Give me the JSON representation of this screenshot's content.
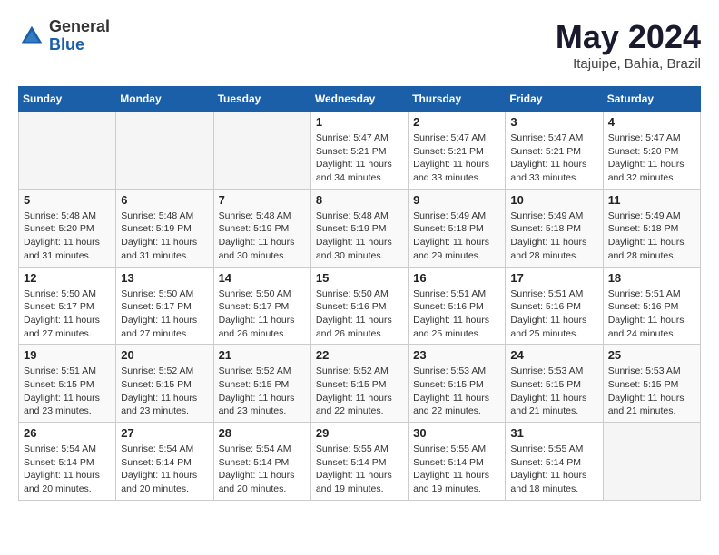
{
  "header": {
    "logo_general": "General",
    "logo_blue": "Blue",
    "month": "May 2024",
    "location": "Itajuipe, Bahia, Brazil"
  },
  "weekdays": [
    "Sunday",
    "Monday",
    "Tuesday",
    "Wednesday",
    "Thursday",
    "Friday",
    "Saturday"
  ],
  "weeks": [
    [
      {
        "day": "",
        "info": ""
      },
      {
        "day": "",
        "info": ""
      },
      {
        "day": "",
        "info": ""
      },
      {
        "day": "1",
        "info": "Sunrise: 5:47 AM\nSunset: 5:21 PM\nDaylight: 11 hours and 34 minutes."
      },
      {
        "day": "2",
        "info": "Sunrise: 5:47 AM\nSunset: 5:21 PM\nDaylight: 11 hours and 33 minutes."
      },
      {
        "day": "3",
        "info": "Sunrise: 5:47 AM\nSunset: 5:21 PM\nDaylight: 11 hours and 33 minutes."
      },
      {
        "day": "4",
        "info": "Sunrise: 5:47 AM\nSunset: 5:20 PM\nDaylight: 11 hours and 32 minutes."
      }
    ],
    [
      {
        "day": "5",
        "info": "Sunrise: 5:48 AM\nSunset: 5:20 PM\nDaylight: 11 hours and 31 minutes."
      },
      {
        "day": "6",
        "info": "Sunrise: 5:48 AM\nSunset: 5:19 PM\nDaylight: 11 hours and 31 minutes."
      },
      {
        "day": "7",
        "info": "Sunrise: 5:48 AM\nSunset: 5:19 PM\nDaylight: 11 hours and 30 minutes."
      },
      {
        "day": "8",
        "info": "Sunrise: 5:48 AM\nSunset: 5:19 PM\nDaylight: 11 hours and 30 minutes."
      },
      {
        "day": "9",
        "info": "Sunrise: 5:49 AM\nSunset: 5:18 PM\nDaylight: 11 hours and 29 minutes."
      },
      {
        "day": "10",
        "info": "Sunrise: 5:49 AM\nSunset: 5:18 PM\nDaylight: 11 hours and 28 minutes."
      },
      {
        "day": "11",
        "info": "Sunrise: 5:49 AM\nSunset: 5:18 PM\nDaylight: 11 hours and 28 minutes."
      }
    ],
    [
      {
        "day": "12",
        "info": "Sunrise: 5:50 AM\nSunset: 5:17 PM\nDaylight: 11 hours and 27 minutes."
      },
      {
        "day": "13",
        "info": "Sunrise: 5:50 AM\nSunset: 5:17 PM\nDaylight: 11 hours and 27 minutes."
      },
      {
        "day": "14",
        "info": "Sunrise: 5:50 AM\nSunset: 5:17 PM\nDaylight: 11 hours and 26 minutes."
      },
      {
        "day": "15",
        "info": "Sunrise: 5:50 AM\nSunset: 5:16 PM\nDaylight: 11 hours and 26 minutes."
      },
      {
        "day": "16",
        "info": "Sunrise: 5:51 AM\nSunset: 5:16 PM\nDaylight: 11 hours and 25 minutes."
      },
      {
        "day": "17",
        "info": "Sunrise: 5:51 AM\nSunset: 5:16 PM\nDaylight: 11 hours and 25 minutes."
      },
      {
        "day": "18",
        "info": "Sunrise: 5:51 AM\nSunset: 5:16 PM\nDaylight: 11 hours and 24 minutes."
      }
    ],
    [
      {
        "day": "19",
        "info": "Sunrise: 5:51 AM\nSunset: 5:15 PM\nDaylight: 11 hours and 23 minutes."
      },
      {
        "day": "20",
        "info": "Sunrise: 5:52 AM\nSunset: 5:15 PM\nDaylight: 11 hours and 23 minutes."
      },
      {
        "day": "21",
        "info": "Sunrise: 5:52 AM\nSunset: 5:15 PM\nDaylight: 11 hours and 23 minutes."
      },
      {
        "day": "22",
        "info": "Sunrise: 5:52 AM\nSunset: 5:15 PM\nDaylight: 11 hours and 22 minutes."
      },
      {
        "day": "23",
        "info": "Sunrise: 5:53 AM\nSunset: 5:15 PM\nDaylight: 11 hours and 22 minutes."
      },
      {
        "day": "24",
        "info": "Sunrise: 5:53 AM\nSunset: 5:15 PM\nDaylight: 11 hours and 21 minutes."
      },
      {
        "day": "25",
        "info": "Sunrise: 5:53 AM\nSunset: 5:15 PM\nDaylight: 11 hours and 21 minutes."
      }
    ],
    [
      {
        "day": "26",
        "info": "Sunrise: 5:54 AM\nSunset: 5:14 PM\nDaylight: 11 hours and 20 minutes."
      },
      {
        "day": "27",
        "info": "Sunrise: 5:54 AM\nSunset: 5:14 PM\nDaylight: 11 hours and 20 minutes."
      },
      {
        "day": "28",
        "info": "Sunrise: 5:54 AM\nSunset: 5:14 PM\nDaylight: 11 hours and 20 minutes."
      },
      {
        "day": "29",
        "info": "Sunrise: 5:55 AM\nSunset: 5:14 PM\nDaylight: 11 hours and 19 minutes."
      },
      {
        "day": "30",
        "info": "Sunrise: 5:55 AM\nSunset: 5:14 PM\nDaylight: 11 hours and 19 minutes."
      },
      {
        "day": "31",
        "info": "Sunrise: 5:55 AM\nSunset: 5:14 PM\nDaylight: 11 hours and 18 minutes."
      },
      {
        "day": "",
        "info": ""
      }
    ]
  ]
}
